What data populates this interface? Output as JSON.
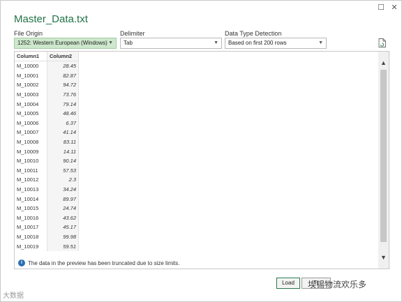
{
  "window": {
    "title": "Master_Data.txt",
    "maximize_glyph": "☐",
    "close_glyph": "✕"
  },
  "options": {
    "file_origin": {
      "label": "File Origin",
      "value": "1252: Western European (Windows)"
    },
    "delimiter": {
      "label": "Delimiter",
      "value": "Tab"
    },
    "detection": {
      "label": "Data Type Detection",
      "value": "Based on first 200 rows"
    }
  },
  "table": {
    "headers": [
      "Column1",
      "Column2"
    ],
    "rows": [
      [
        "M_10000",
        "28.45"
      ],
      [
        "M_10001",
        "82.87"
      ],
      [
        "M_10002",
        "94.72"
      ],
      [
        "M_10003",
        "73.76"
      ],
      [
        "M_10004",
        "79.14"
      ],
      [
        "M_10005",
        "48.46"
      ],
      [
        "M_10006",
        "6.37"
      ],
      [
        "M_10007",
        "41.14"
      ],
      [
        "M_10008",
        "83.11"
      ],
      [
        "M_10009",
        "14.11"
      ],
      [
        "M_10010",
        "90.14"
      ],
      [
        "M_10011",
        "57.53"
      ],
      [
        "M_10012",
        "2.3"
      ],
      [
        "M_10013",
        "34.24"
      ],
      [
        "M_10014",
        "89.97"
      ],
      [
        "M_10015",
        "24.74"
      ],
      [
        "M_10016",
        "43.62"
      ],
      [
        "M_10017",
        "45.17"
      ],
      [
        "M_10018",
        "99.98"
      ],
      [
        "M_10019",
        "59.51"
      ]
    ]
  },
  "truncation_notice": "The data in the preview has been truncated due to size limits.",
  "buttons": {
    "load": "Load",
    "transform": "Tr"
  },
  "overlay_text": "埃锡物流欢乐多",
  "watermark": "大数据"
}
